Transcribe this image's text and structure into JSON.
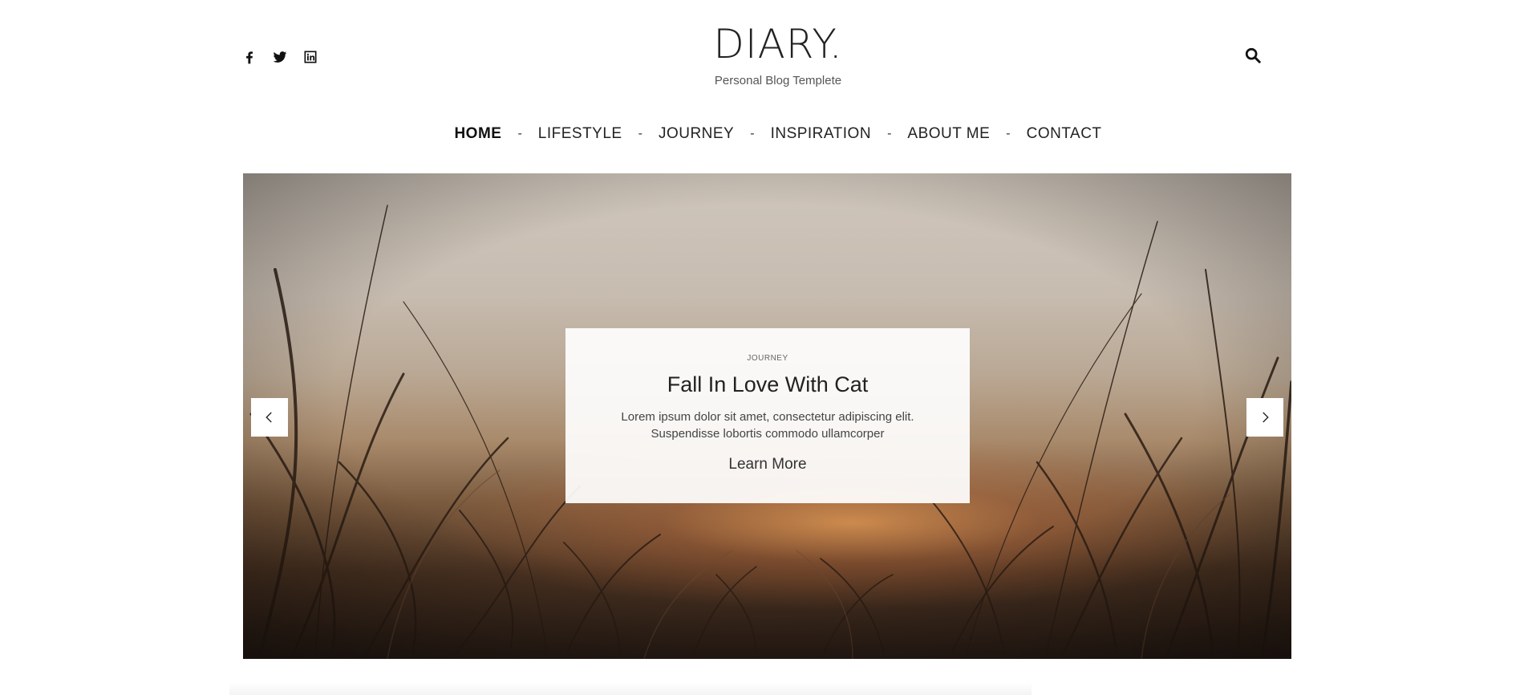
{
  "header": {
    "social": [
      {
        "name": "facebook-icon"
      },
      {
        "name": "twitter-icon"
      },
      {
        "name": "linkedin-icon"
      }
    ],
    "logo": "DIARY.",
    "tagline": "Personal Blog Templete",
    "search_icon": "search-icon"
  },
  "nav": {
    "items": [
      "HOME",
      "LIFESTYLE",
      "JOURNEY",
      "INSPIRATION",
      "ABOUT ME",
      "CONTACT"
    ],
    "separator": "-",
    "active": "HOME"
  },
  "hero": {
    "category": "JOURNEY",
    "title": "Fall In Love With Cat",
    "excerpt": "Lorem ipsum dolor sit amet, consectetur adipiscing elit. Suspendisse lobortis commodo ullamcorper",
    "cta": "Learn More",
    "prev_icon": "chevron-left-icon",
    "next_icon": "chevron-right-icon"
  }
}
